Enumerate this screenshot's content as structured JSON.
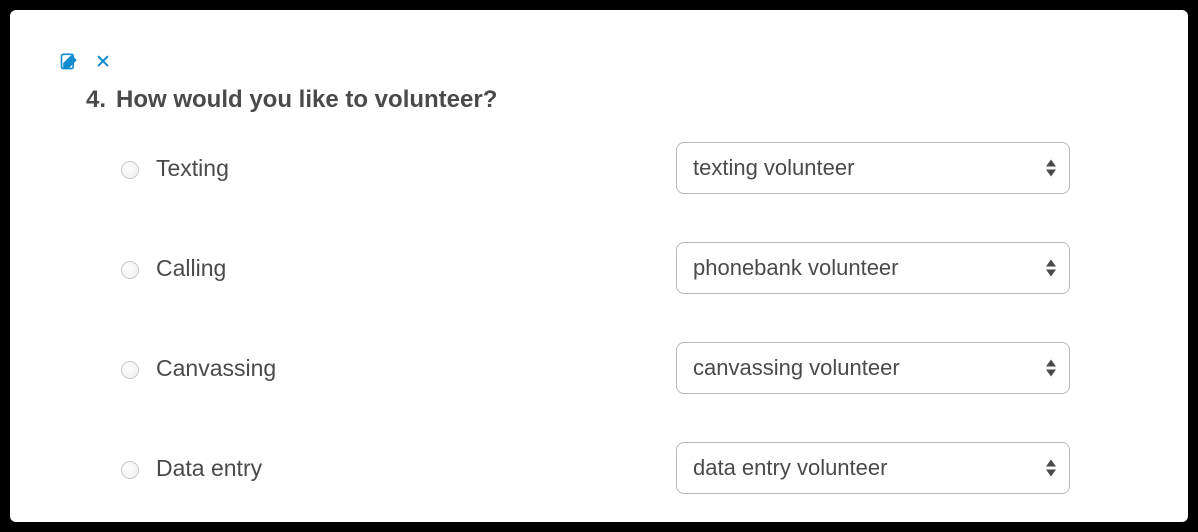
{
  "question": {
    "number": "4.",
    "text": "How would you like to volunteer?"
  },
  "options": [
    {
      "label": "Texting",
      "select_value": "texting volunteer"
    },
    {
      "label": "Calling",
      "select_value": "phonebank volunteer"
    },
    {
      "label": "Canvassing",
      "select_value": "canvassing volunteer"
    },
    {
      "label": "Data entry",
      "select_value": "data entry volunteer"
    }
  ],
  "colors": {
    "accent": "#128ccf",
    "text": "#4a4a4a",
    "border": "#b8b8b8"
  }
}
